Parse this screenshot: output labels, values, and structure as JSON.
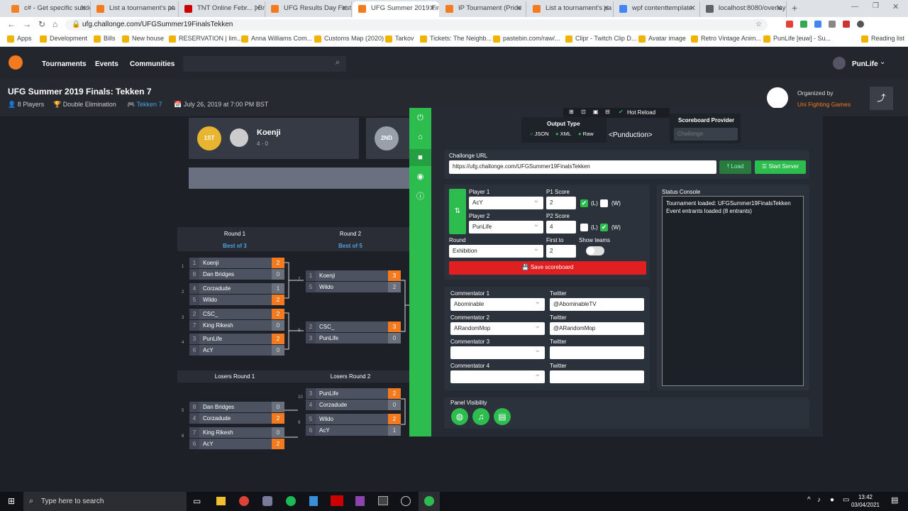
{
  "tabs": [
    "c# - Get specific subdo",
    "List a tournament's pa",
    "TNT Online Febr... | Br",
    "UFG Results Day Fest",
    "UFG Summer 2019 Fin",
    "IP Tournament (Pride",
    "List a tournament's pa",
    "wpf contenttemplate",
    "localhost:8080/overlay"
  ],
  "url": "ufg.challonge.com/UFGSummer19FinalsTekken",
  "bookmarks": [
    "Apps",
    "Development",
    "Bills",
    "New house",
    "RESERVATION | lim...",
    "Anna Williams Com...",
    "Customs Map (2020)",
    "Tarkov",
    "Tickets: The Neighb...",
    "pastebin.com/raw/...",
    "Clipr - Twitch Clip D...",
    "Avatar image",
    "Retro Vintage Anim...",
    "PunLife [euw] - Su..."
  ],
  "reading_list": "Reading list",
  "nav": {
    "links": [
      "Tournaments",
      "Events",
      "Communities"
    ],
    "user": "PunLife"
  },
  "tournament": {
    "title": "UFG Summer 2019 Finals: Tekken 7",
    "players": "8 Players",
    "format": "Double Elimination",
    "game": "Tekken 7",
    "date": "July 26, 2019 at 7:00 PM BST",
    "organized_by": "Organized by",
    "organizer": "Uni Fighting Games"
  },
  "podium": {
    "first_badge": "1ST",
    "first_name": "Koenji",
    "first_record": "4 - 0",
    "second_badge": "2ND"
  },
  "bracket": {
    "rounds": [
      {
        "name": "Round 1",
        "best": "Best of 3"
      },
      {
        "name": "Round 2",
        "best": "Best of 5"
      }
    ],
    "losers_rounds": [
      "Losers Round 1",
      "Losers Round 2"
    ],
    "winners_r1": [
      [
        [
          "1",
          "Koenji",
          "2"
        ],
        [
          "8",
          "Dan Bridges",
          "0"
        ]
      ],
      [
        [
          "4",
          "Corzadude",
          "1"
        ],
        [
          "5",
          "Wildo",
          "2"
        ]
      ],
      [
        [
          "2",
          "CSC_",
          "2"
        ],
        [
          "7",
          "King Rikesh",
          "0"
        ]
      ],
      [
        [
          "3",
          "PunLife",
          "2"
        ],
        [
          "6",
          "AcY",
          "0"
        ]
      ]
    ],
    "winners_r2": [
      [
        [
          "1",
          "Koenji",
          "3"
        ],
        [
          "5",
          "Wildo",
          "2"
        ]
      ],
      [
        [
          "2",
          "CSC_",
          "3"
        ],
        [
          "3",
          "PunLife",
          "0"
        ]
      ]
    ],
    "losers_r1": [
      [
        [
          "8",
          "Dan Bridges",
          "0"
        ],
        [
          "4",
          "Corzadude",
          "2"
        ]
      ],
      [
        [
          "7",
          "King Rikesh",
          "0"
        ],
        [
          "6",
          "AcY",
          "2"
        ]
      ]
    ],
    "losers_r2": [
      [
        [
          "3",
          "PunLife",
          "2"
        ],
        [
          "4",
          "Corzadude",
          "0"
        ]
      ],
      [
        [
          "5",
          "Wildo",
          "2"
        ],
        [
          "6",
          "AcY",
          "1"
        ]
      ]
    ],
    "match_ids": [
      "1",
      "2",
      "3",
      "4",
      "7",
      "8",
      "5",
      "6",
      "10",
      "9"
    ]
  },
  "overlay": {
    "hot_reload": "Hot Reload",
    "output_type": "Output Type",
    "formats": [
      "JSON",
      "XML",
      "Raw"
    ],
    "logo": "<Punduction>",
    "provider_label": "Scoreboard Provider",
    "provider_value": "Challonge",
    "challonge_label": "Challonge URL",
    "challonge_url": "https://ufg.challonge.com/UFGSummer19FinalsTekken",
    "load": "Load",
    "start": "Start Server",
    "p1_label": "Player 1",
    "p1": "AcY",
    "p1_score_label": "P1 Score",
    "p1_score": "2",
    "p2_label": "Player 2",
    "p2": "PunLife",
    "p2_score_label": "P2 Score",
    "p2_score": "4",
    "l": "(L)",
    "w": "(W)",
    "round_label": "Round",
    "round": "Exhibition",
    "first_to_label": "First to",
    "first_to": "2",
    "show_teams": "Show teams",
    "save": "Save scoreboard",
    "commentators": [
      {
        "label": "Commentator 1",
        "name": "Abominable",
        "twitter": "@AbominableTV"
      },
      {
        "label": "Commentator 2",
        "name": "ARandomMop",
        "twitter": "@ARandomMop"
      },
      {
        "label": "Commentator 3",
        "name": "",
        "twitter": ""
      },
      {
        "label": "Commentator 4",
        "name": "",
        "twitter": ""
      }
    ],
    "twitter_label": "Twitter",
    "status_label": "Status Console",
    "status": [
      "Tournament loaded: UFGSummer19FinalsTekken",
      "Event entrants loaded (8 entrants)"
    ],
    "panel_visibility": "Panel Visibility"
  },
  "taskbar": {
    "search": "Type here to search",
    "time": "13:42",
    "date": "03/04/2021"
  },
  "colors": {
    "accent": "#f47a20",
    "green": "#2dbc4e",
    "red": "#e02020"
  }
}
